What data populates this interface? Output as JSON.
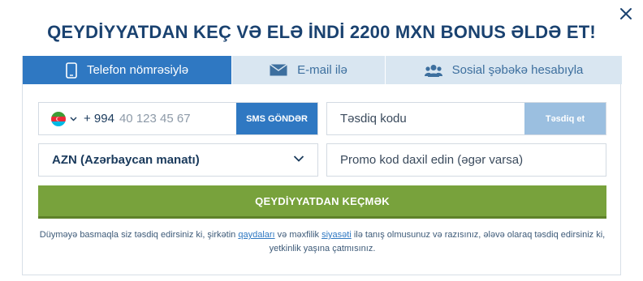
{
  "title": "QEYDİYYATDAN KEÇ VƏ ELƏ İNDİ 2200 MXN BONUS ƏLDƏ ET!",
  "tabs": [
    {
      "label": "Telefon nömrəsiylə",
      "icon": "phone-icon",
      "active": true
    },
    {
      "label": "E-mail ilə",
      "icon": "envelope-icon",
      "active": false
    },
    {
      "label": "Sosial şəbəkə hesabıyla",
      "icon": "users-icon",
      "active": false
    }
  ],
  "phone": {
    "country_flag": "azerbaijan-flag-icon",
    "code": "+ 994",
    "placeholder": "40 123 45 67",
    "sms_button": "SMS GÖNDƏR"
  },
  "confirm": {
    "placeholder": "Təsdiq kodu",
    "button": "Təsdiq et"
  },
  "currency": {
    "selected": "AZN (Azərbaycan manatı)"
  },
  "promo": {
    "placeholder": "Promo kod daxil edin (əgər varsa)"
  },
  "register_button": "QEYDİYYATDAN KEÇMƏK",
  "disclaimer": {
    "part1": "Düyməyə basmaqla siz təsdiq edirsiniz ki, şirkətin ",
    "link1": "qaydaları",
    "part2": " və məxfilik ",
    "link2": "siyasəti",
    "part3": " ilə tanış olmusunuz və razısınız, ələvə olaraq təsdiq edirsiniz ki, yetkinlik yaşına çatmısınız."
  },
  "colors": {
    "primary": "#2f78c2",
    "tab_inactive": "#d9e6f1",
    "register": "#78a23c",
    "confirm_disabled": "#9bbfe0",
    "title": "#1a4270"
  }
}
